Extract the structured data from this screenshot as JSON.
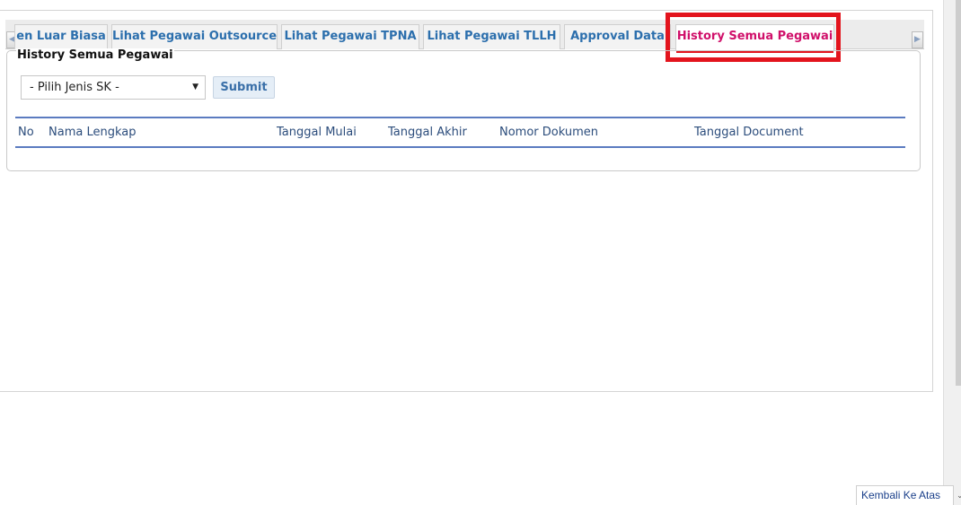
{
  "tabs": [
    {
      "label": "en Luar Biasa",
      "active": false
    },
    {
      "label": "Lihat Pegawai Outsource",
      "active": false
    },
    {
      "label": "Lihat Pegawai TPNA",
      "active": false
    },
    {
      "label": "Lihat Pegawai TLLH",
      "active": false
    },
    {
      "label": "Approval Data",
      "active": false
    },
    {
      "label": "History Semua Pegawai",
      "active": true
    }
  ],
  "tab_scroll": {
    "left_icon": "chevron-left-icon",
    "right_icon": "chevron-right-icon",
    "left_glyph": "◀",
    "right_glyph": "▶"
  },
  "section": {
    "title": "History Semua Pegawai"
  },
  "form": {
    "select_value": "- Pilih Jenis SK -",
    "select_arrow": "▼",
    "submit_label": "Submit"
  },
  "table": {
    "headers": [
      "No",
      "Nama Lengkap",
      "Tanggal Mulai",
      "Tanggal Akhir",
      "Nomor Dokumen",
      "Tanggal Document"
    ],
    "rows": []
  },
  "footer": {
    "back_to_top": "Kembali Ke Atas",
    "corner_glyph": "⌄"
  },
  "colors": {
    "highlight": "#e3141d",
    "active_tab_text": "#d0106a",
    "tab_text": "#2c6fad",
    "header_line": "#5b7bc0"
  }
}
